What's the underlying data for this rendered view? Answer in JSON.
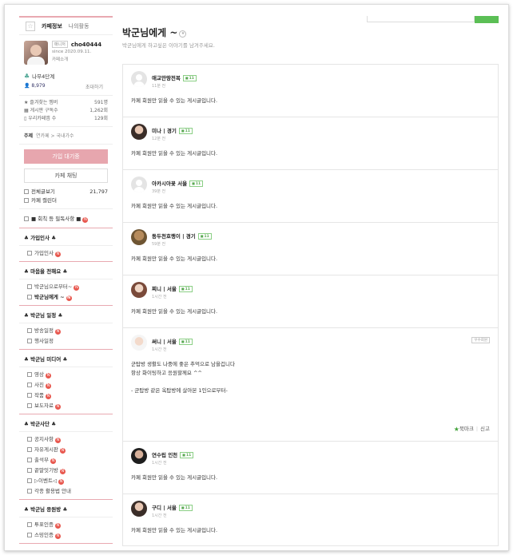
{
  "sidebar": {
    "tabs": [
      {
        "label": "카페정보"
      },
      {
        "label": "나의활동"
      }
    ],
    "profile": {
      "role": "매니저",
      "nickname": "cho40444",
      "since": "since 2020.09.11.",
      "intro": "카페소개"
    },
    "level": "나무4단계",
    "members": {
      "count": "8,979",
      "invite": "초대하기"
    },
    "stats": [
      {
        "label": "즐겨찾는 멤버",
        "value": "591명"
      },
      {
        "label": "게시판 구독수",
        "value": "1,262회"
      },
      {
        "label": "우리카페앱 수",
        "value": "129회"
      }
    ],
    "topic": {
      "label": "주제",
      "value": "연카페 > 국내가수"
    },
    "join_button": "가입 대기중",
    "chat_button": "카페 채팅",
    "quick": [
      {
        "label": "전체글보기",
        "value": "21,797"
      },
      {
        "label": "카페 캘린더",
        "value": ""
      }
    ],
    "notice": "■ 회칙 등 필독사항 ■",
    "menu_groups": [
      {
        "title": "♣ 가입인사 ♣",
        "items": [
          {
            "label": "가입인사",
            "new": true,
            "active": false
          }
        ]
      },
      {
        "title": "♣ 마음을 전해요 ♣",
        "items": [
          {
            "label": "박군님으로부터~",
            "new": true,
            "active": false
          },
          {
            "label": "박군님에게 ~",
            "new": true,
            "active": true
          }
        ]
      },
      {
        "title": "♣ 박군님 일정 ♣",
        "items": [
          {
            "label": "방송일정",
            "new": true,
            "active": false
          },
          {
            "label": "행사일정",
            "new": false,
            "active": false
          }
        ]
      },
      {
        "title": "♣ 박군님 미디어 ♣",
        "items": [
          {
            "label": "영상",
            "new": true,
            "active": false
          },
          {
            "label": "사진",
            "new": true,
            "active": false
          },
          {
            "label": "작품",
            "new": true,
            "active": false
          },
          {
            "label": "보도자료",
            "new": true,
            "active": false
          }
        ]
      },
      {
        "title": "♣ 박군사단 ♣",
        "items": [
          {
            "label": "공지사항",
            "new": true,
            "active": false
          },
          {
            "label": "자유게시판",
            "new": true,
            "active": false
          },
          {
            "label": "출석부",
            "new": true,
            "active": false
          },
          {
            "label": "끝말잇기방",
            "new": true,
            "active": false
          },
          {
            "label": "▷이벤트◁",
            "new": true,
            "active": false
          },
          {
            "label": "각종 활용법 안내",
            "new": false,
            "active": false
          }
        ]
      },
      {
        "title": "♣ 박군님 응원방 ♣",
        "items": [
          {
            "label": "투표인증",
            "new": true,
            "active": false
          },
          {
            "label": "스밍인증",
            "new": true,
            "active": false
          }
        ]
      }
    ]
  },
  "main": {
    "title": "박군님에게 ~",
    "description": "박군님에게 하고싶은 이야기를 남겨주세요.",
    "search_button": "검색",
    "posts": [
      {
        "name": "애교만땅전복",
        "level": "11",
        "time": "11분 전",
        "avatar": "default",
        "body": [
          "카페 회원만 읽을 수 있는 게시글입니다."
        ]
      },
      {
        "name": "미나 | 경기",
        "level": "11",
        "time": "12분 전",
        "avatar": "photo",
        "body": [
          "카페 회원만 읽을 수 있는 게시글입니다."
        ]
      },
      {
        "name": "아카시아꽃 서울",
        "level": "11",
        "time": "39분 전",
        "avatar": "default",
        "body": [
          "카페 회원만 읽을 수 있는 게시글입니다."
        ]
      },
      {
        "name": "동두천호랭이 | 경기",
        "level": "11",
        "time": "59분 전",
        "avatar": "photo4",
        "body": [
          "카페 회원만 읽을 수 있는 게시글입니다."
        ]
      },
      {
        "name": "찌니 | 서울",
        "level": "11",
        "time": "1시간 전",
        "avatar": "photo2",
        "body": [
          "카페 회원만 읽을 수 있는 게시글입니다."
        ]
      },
      {
        "name": "써니 | 서울",
        "level": "11",
        "time": "1시간 전",
        "avatar": "photo3",
        "tag": "우수회원",
        "body": [
          "군탑방 생활도 나중에 좋은 추억으로 남을겁니다",
          "항상 화이팅하고 응원할께요 ^^",
          "",
          "- 군탑방 같은 옥탑방에 살아본 1인으로부터-"
        ],
        "bookmark": "북마크",
        "report": "신고"
      },
      {
        "name": "연수립 인천",
        "level": "11",
        "time": "1시간 전",
        "avatar": "photo5",
        "body": [
          "카페 회원만 읽을 수 있는 게시글입니다."
        ]
      },
      {
        "name": "구디 | 서울",
        "level": "11",
        "time": "1시간 전",
        "avatar": "photo",
        "body": [
          "카페 회원만 읽을 수 있는 게시글입니다."
        ]
      }
    ]
  }
}
